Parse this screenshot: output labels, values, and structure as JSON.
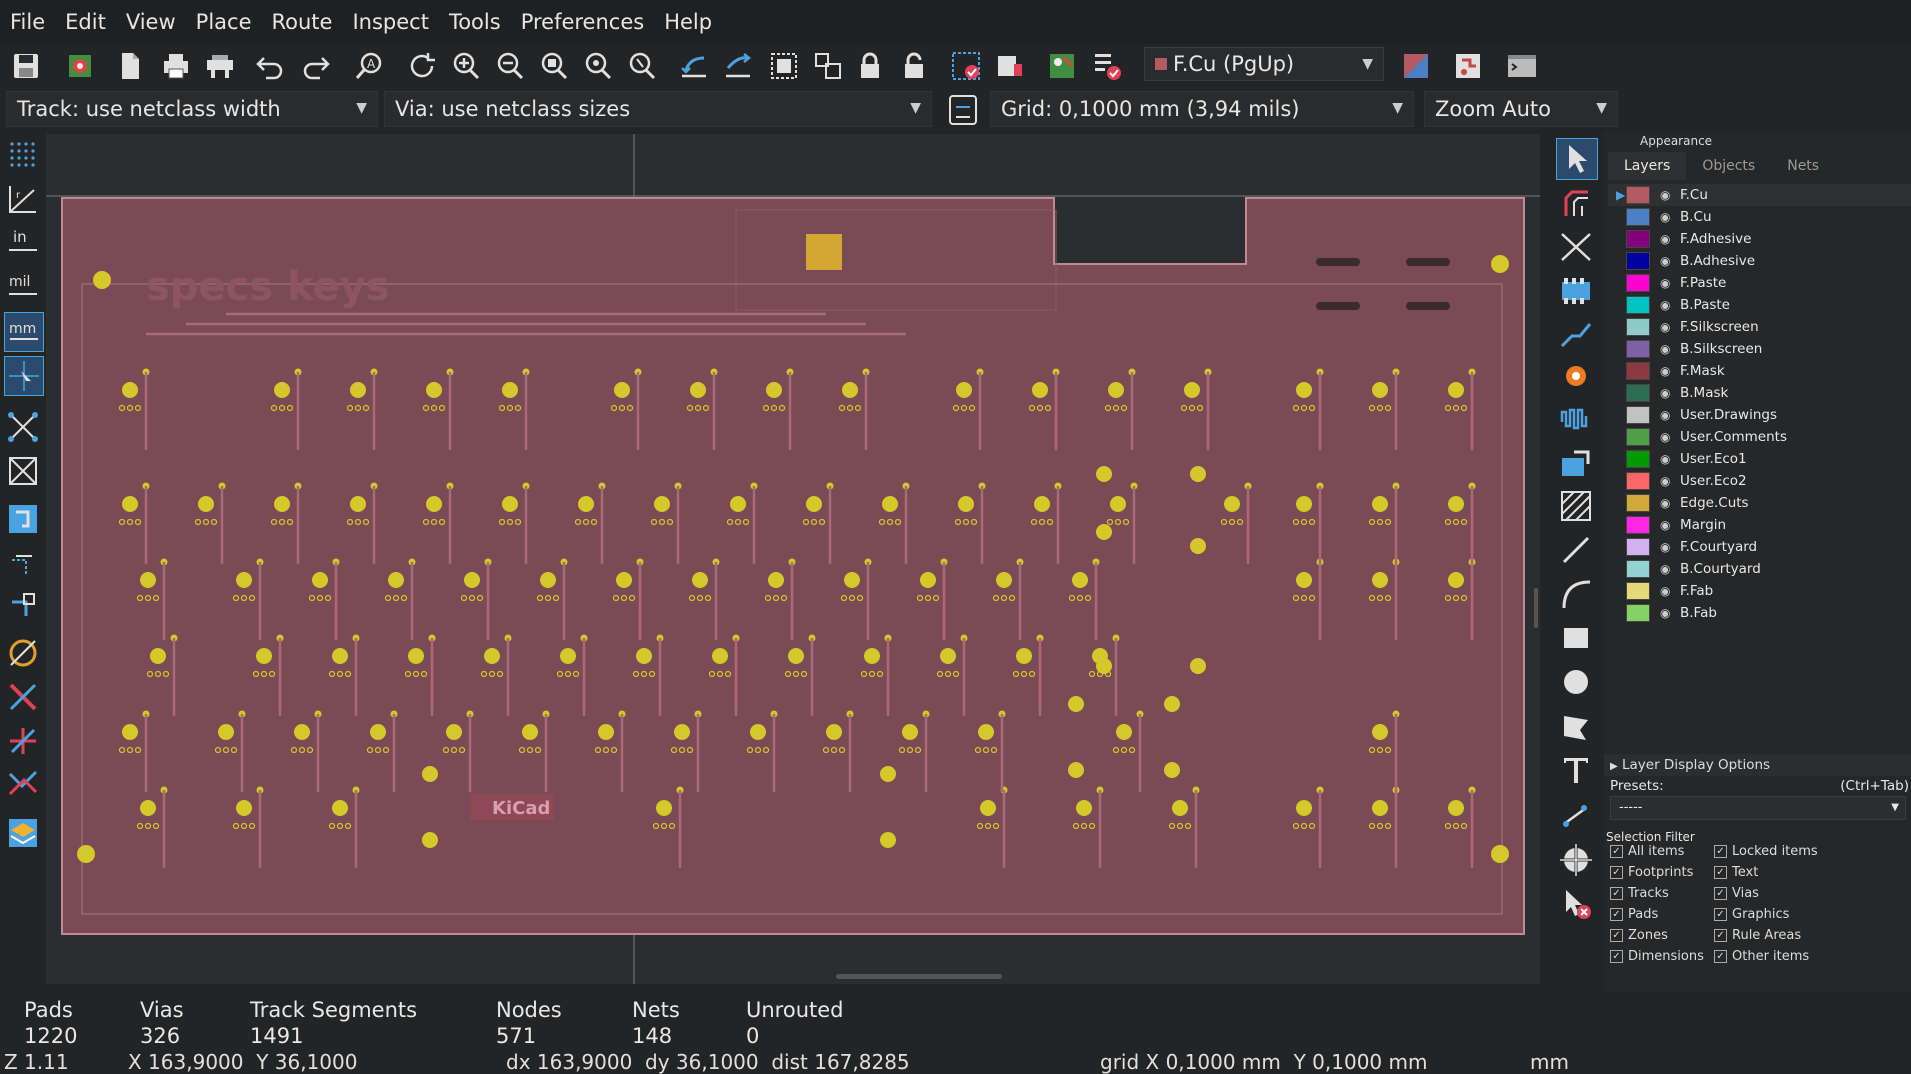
{
  "menubar": {
    "items": [
      "File",
      "Edit",
      "View",
      "Place",
      "Route",
      "Inspect",
      "Tools",
      "Preferences",
      "Help"
    ]
  },
  "toolbar": {
    "icons": [
      "save-icon",
      "board-setup-icon",
      "page-settings-icon",
      "print-icon",
      "plot-icon",
      "undo-icon",
      "redo-icon",
      "find-icon",
      "redraw-icon",
      "zoom-in-icon",
      "zoom-out-icon",
      "zoom-fit-icon",
      "zoom-objects-icon",
      "zoom-selection-icon",
      "rotate-ccw-icon",
      "rotate-cw-icon",
      "group-icon",
      "ungroup-icon",
      "lock-icon",
      "unlock-icon",
      "netlist-update-icon",
      "footprint-editor-icon",
      "footprint-browser-icon",
      "drc-icon"
    ],
    "layer_selector": "F.Cu (PgUp)"
  },
  "bar2": {
    "track": "Track: use netclass width",
    "via": "Via: use netclass sizes",
    "grid": "Grid: 0,1000 mm (3,94 mils)",
    "zoom": "Zoom Auto"
  },
  "left_toolbar": {
    "icons": [
      "grid-dots-icon",
      "polar-coords-icon",
      "inch-units-icon",
      "mil-units-icon",
      "mm-units-icon",
      "cursor-full-icon",
      "ratsnest-icon",
      "curved-ratsnest-icon",
      "zones-fill-icon",
      "zones-outline-icon",
      "pads-outline-icon",
      "vias-outline-icon",
      "tracks-outline-icon",
      "high-contrast-icon",
      "net-inspector-icon",
      "layer-toggle-icon"
    ]
  },
  "right_toolbar": {
    "icons": [
      "select-arrow-icon",
      "route-track-icon",
      "route-diff-pair-icon",
      "footprint-icon",
      "track-icon",
      "via-icon",
      "tune-length-icon",
      "add-zone-icon",
      "rule-area-icon",
      "line-icon",
      "arc-icon",
      "rectangle-icon",
      "circle-icon",
      "polygon-icon",
      "text-icon",
      "dimension-icon",
      "origin-icon",
      "delete-icon"
    ]
  },
  "appearance": {
    "title": "Appearance",
    "tabs": [
      "Layers",
      "Objects",
      "Nets"
    ],
    "active_tab": "Layers",
    "layers": [
      {
        "name": "F.Cu",
        "color": "#b35a63"
      },
      {
        "name": "B.Cu",
        "color": "#4d7fc4"
      },
      {
        "name": "F.Adhesive",
        "color": "#84007a"
      },
      {
        "name": "B.Adhesive",
        "color": "#0000a0"
      },
      {
        "name": "F.Paste",
        "color": "#ff00d2"
      },
      {
        "name": "B.Paste",
        "color": "#00c2c2"
      },
      {
        "name": "F.Silkscreen",
        "color": "#8fcac9"
      },
      {
        "name": "B.Silkscreen",
        "color": "#7c61a6"
      },
      {
        "name": "F.Mask",
        "color": "#8c3942"
      },
      {
        "name": "B.Mask",
        "color": "#2d6d55"
      },
      {
        "name": "User.Drawings",
        "color": "#c2c2c2"
      },
      {
        "name": "User.Comments",
        "color": "#4f9e4a"
      },
      {
        "name": "User.Eco1",
        "color": "#009900"
      },
      {
        "name": "User.Eco2",
        "color": "#ff6565"
      },
      {
        "name": "Edge.Cuts",
        "color": "#d0a83b"
      },
      {
        "name": "Margin",
        "color": "#ff26e2"
      },
      {
        "name": "F.Courtyard",
        "color": "#d3b0f0"
      },
      {
        "name": "B.Courtyard",
        "color": "#95d2d2"
      },
      {
        "name": "F.Fab",
        "color": "#e5d97a"
      },
      {
        "name": "B.Fab",
        "color": "#85d165"
      }
    ],
    "layer_display_options": "Layer Display Options",
    "presets_label": "Presets:",
    "presets_shortcut": "(Ctrl+Tab)",
    "presets_value": "-----",
    "selection_filter": "Selection Filter",
    "filters_left": [
      "All items",
      "Footprints",
      "Tracks",
      "Pads",
      "Zones",
      "Dimensions"
    ],
    "filters_right": [
      "Locked items",
      "Text",
      "Vias",
      "Graphics",
      "Rule Areas",
      "Other items"
    ]
  },
  "status": {
    "columns": [
      {
        "label": "Pads",
        "value": "1220"
      },
      {
        "label": "Vias",
        "value": "326"
      },
      {
        "label": "Track Segments",
        "value": "1491"
      },
      {
        "label": "Nodes",
        "value": "571"
      },
      {
        "label": "Nets",
        "value": "148"
      },
      {
        "label": "Unrouted",
        "value": "0"
      }
    ]
  },
  "coords": {
    "zoom": "Z 1.11",
    "xy": "X 163,9000  Y 36,1000",
    "delta": "dx 163,9000  dy 36,1000  dist 167,8285",
    "grid": "grid X 0,1000 mm  Y 0,1000 mm",
    "units": "mm"
  },
  "board": {
    "silk_text": "specs keys",
    "logo_text": "KiCad"
  }
}
